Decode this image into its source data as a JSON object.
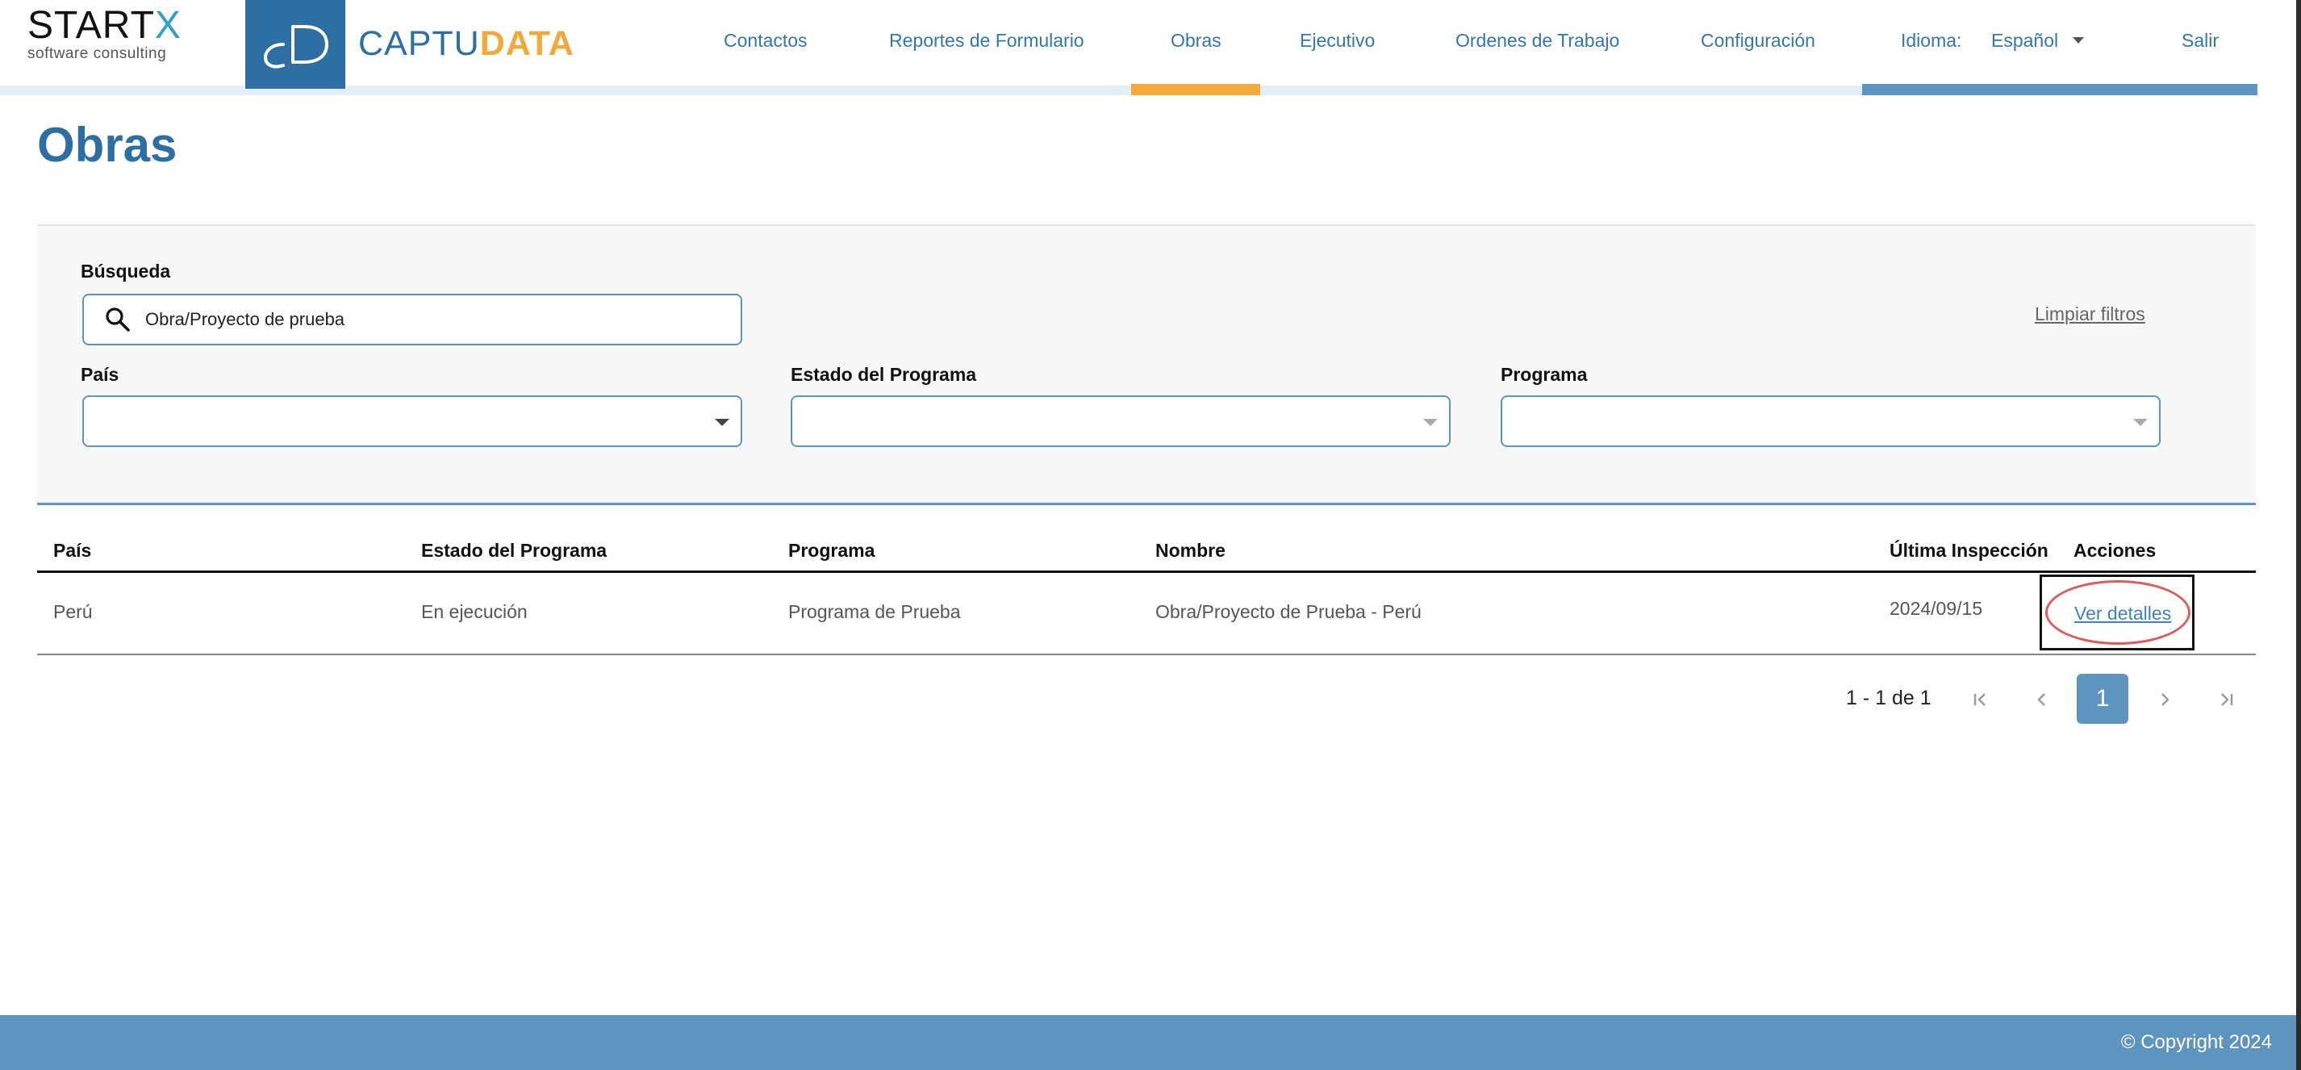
{
  "header": {
    "startx_logo": {
      "word_main": "START",
      "word_x": "X",
      "tagline": "software consulting"
    },
    "captudata_logo": {
      "part_a": "CAPTU",
      "part_b": "DATA",
      "mark": "cD"
    },
    "nav": [
      {
        "id": "contactos",
        "label": "Contactos"
      },
      {
        "id": "reportes",
        "label": "Reportes de Formulario"
      },
      {
        "id": "obras",
        "label": "Obras",
        "active": true
      },
      {
        "id": "ejecutivo",
        "label": "Ejecutivo"
      },
      {
        "id": "ordenes",
        "label": "Ordenes de Trabajo"
      },
      {
        "id": "configuracion",
        "label": "Configuración"
      }
    ],
    "language_label": "Idioma:",
    "language_value": "Español",
    "logout_label": "Salir"
  },
  "page_title": "Obras",
  "filters": {
    "search_label": "Búsqueda",
    "search_value": "Obra/Proyecto de prueba",
    "clear_label": "Limpiar filtros",
    "country_label": "País",
    "country_value": "",
    "status_label": "Estado del Programa",
    "status_value": "",
    "program_label": "Programa",
    "program_value": ""
  },
  "table": {
    "columns": [
      "País",
      "Estado del Programa",
      "Programa",
      "Nombre",
      "Última Inspección",
      "Acciones"
    ],
    "rows": [
      {
        "pais": "Perú",
        "estado": "En ejecución",
        "programa": "Programa de Prueba",
        "nombre": "Obra/Proyecto de Prueba - Perú",
        "ultima_inspeccion": "2024/09/15",
        "accion": "Ver detalles"
      }
    ]
  },
  "pagination": {
    "range_text": "1 - 1 de 1",
    "current_page": "1"
  },
  "footer": {
    "copyright": "© Copyright 2024"
  },
  "colors": {
    "brand_blue": "#2e6fa3",
    "accent_orange": "#f4a93a",
    "panel_blue": "#5e95c0",
    "highlight_red": "#e05b5b"
  }
}
